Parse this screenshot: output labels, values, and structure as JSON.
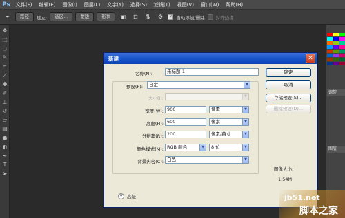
{
  "app": {
    "logo": "Ps",
    "menu": [
      "文件(F)",
      "编辑(E)",
      "图像(I)",
      "图层(L)",
      "文字(Y)",
      "选择(S)",
      "滤镜(T)",
      "视图(V)",
      "窗口(W)",
      "帮助(H)"
    ]
  },
  "options": {
    "mode": "路径",
    "make_label": "建立:",
    "selection_btn": "选区...",
    "mask_btn": "蒙版",
    "shape_btn": "形状",
    "auto_add_label": "自动添加/删除",
    "align_edges_label": "对齐边缘"
  },
  "panels": {
    "adjust_tab": "调整",
    "layers_tab": "图层"
  },
  "dialog": {
    "title": "新建",
    "name_label": "名称(N):",
    "name_value": "未标题-1",
    "preset_label": "预设(P):",
    "preset_value": "自定",
    "size_label": "大小(I):",
    "size_value": "",
    "width_label": "宽度(W):",
    "width_value": "900",
    "width_unit": "像素",
    "height_label": "高度(H):",
    "height_value": "600",
    "height_unit": "像素",
    "resolution_label": "分辨率(R):",
    "resolution_value": "200",
    "resolution_unit": "像素/英寸",
    "color_mode_label": "颜色模式(M):",
    "color_mode_value": "RGB 颜色",
    "bit_depth_value": "8 位",
    "background_label": "背景内容(C):",
    "background_value": "白色",
    "advanced_label": "高级",
    "ok_button": "确定",
    "cancel_button": "取消",
    "save_preset_button": "存储预设(S)...",
    "delete_preset_button": "删除预设(D)...",
    "image_size_title": "图像大小:",
    "image_size_value": "1.54M"
  },
  "watermark": {
    "site": "jb51.net",
    "brand": "脚本之家"
  },
  "colors": {
    "titlebar": "#1450c8",
    "dialog_bg": "#ece9d8",
    "canvas_bg": "#2a2a2a",
    "close_btn": "#c4391c"
  }
}
